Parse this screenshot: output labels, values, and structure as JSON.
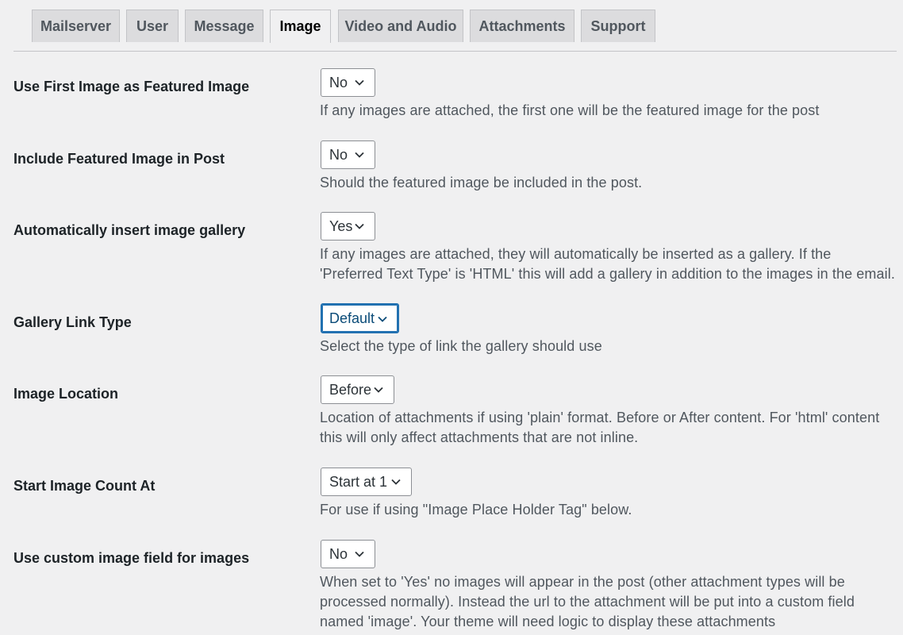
{
  "tabs": [
    {
      "label": "Mailserver"
    },
    {
      "label": "User"
    },
    {
      "label": "Message"
    },
    {
      "label": "Image",
      "active": true
    },
    {
      "label": "Video and Audio"
    },
    {
      "label": "Attachments"
    },
    {
      "label": "Support"
    }
  ],
  "settings": [
    {
      "label": "Use First Image as Featured Image",
      "value": "No",
      "description": "If any images are attached, the first one will be the featured image for the post"
    },
    {
      "label": "Include Featured Image in Post",
      "value": "No",
      "description": "Should the featured image be included in the post."
    },
    {
      "label": "Automatically insert image gallery",
      "value": "Yes",
      "description": "If any images are attached, they will automatically be inserted as a gallery. If the 'Preferred Text Type' is 'HTML' this will add a gallery in addition to the images in the email."
    },
    {
      "label": "Gallery Link Type",
      "value": "Default",
      "focused": true,
      "description": "Select the type of link the gallery should use"
    },
    {
      "label": "Image Location",
      "value": "Before",
      "description": "Location of attachments if using 'plain' format. Before or After content. For 'html' content this will only affect attachments that are not inline."
    },
    {
      "label": "Start Image Count At",
      "value": "Start at 1",
      "description": "For use if using \"Image Place Holder Tag\" below."
    },
    {
      "label": "Use custom image field for images",
      "value": "No",
      "description": "When set to 'Yes' no images will appear in the post (other attachment types will be processed normally). Instead the url to the attachment will be put into a custom field named 'image'. Your theme will need logic to display these attachments"
    }
  ],
  "icons": {
    "select_arrow": "chevron-down-icon"
  },
  "colors": {
    "focus_border": "#2271b1",
    "background": "#f0f0f1",
    "tab_inactive": "#dcdcde"
  }
}
